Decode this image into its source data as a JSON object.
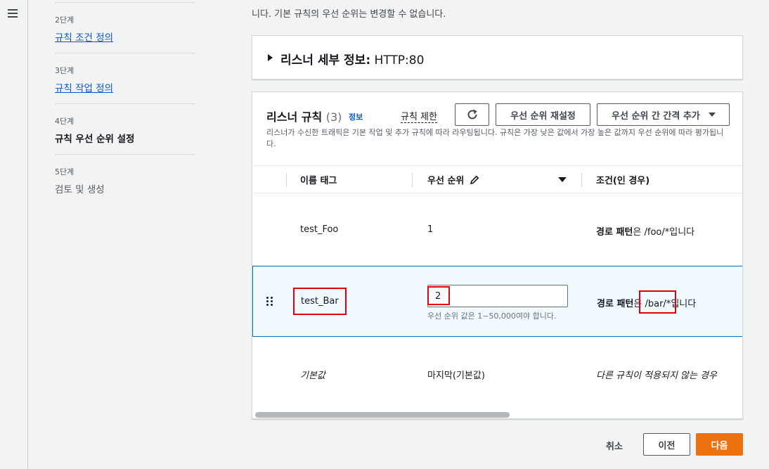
{
  "nav": {
    "menu_icon": "hamburger-menu-icon"
  },
  "steps": [
    {
      "num": "2단계",
      "label": "규칙 조건 정의",
      "state": "link"
    },
    {
      "num": "3단계",
      "label": "규칙 작업 정의",
      "state": "link"
    },
    {
      "num": "4단계",
      "label": "규칙 우선 순위 설정",
      "state": "current"
    },
    {
      "num": "5단계",
      "label": "검토 및 생성",
      "state": "future"
    }
  ],
  "intro_text": "니다. 기본 규칙의 우선 순위는 변경할 수 없습니다.",
  "listener_details": {
    "label": "리스너 세부 정보:",
    "value": "HTTP:80"
  },
  "rules": {
    "title": "리스너 규칙",
    "count": "(3)",
    "info": "정보",
    "limit_link": "규칙 제한",
    "refresh_icon": "refresh-icon",
    "reset_button": "우선 순위 재설정",
    "spacing_button": "우선 순위 간 간격 추가",
    "description": "리스너가 수신한 트래픽은 기본 작업 및 추가 규칙에 따라 라우팅됩니다. 규칙은 가장 낮은 값에서 가장 높은 값까지 우선 순위에 따라 평가됩니다.",
    "columns": {
      "name": "이름 태그",
      "priority": "우선 순위",
      "conditions": "조건(인 경우)"
    },
    "rows": [
      {
        "name": "test_Foo",
        "priority": "1",
        "cond_label": "경로 패턴",
        "cond_particle": "은",
        "cond_value": "/foo/*",
        "cond_suffix": "입니다"
      },
      {
        "name": "test_Bar",
        "priority": "2",
        "priority_help": "우선 순위 값은 1~50,000여야 합니다.",
        "cond_label": "경로 패턴",
        "cond_particle": "은",
        "cond_value": "/bar/*",
        "cond_suffix": "입니다"
      },
      {
        "name": "기본값",
        "priority": "마지막(기본값)",
        "cond_text": "다른 규칙이 적용되지 않는 경우"
      }
    ]
  },
  "footer": {
    "cancel": "취소",
    "prev": "이전",
    "next": "다음"
  },
  "colors": {
    "accent": "#ec7211",
    "link": "#0a58ca",
    "highlight": "#e1000e",
    "selected_row": "#f1faff"
  }
}
